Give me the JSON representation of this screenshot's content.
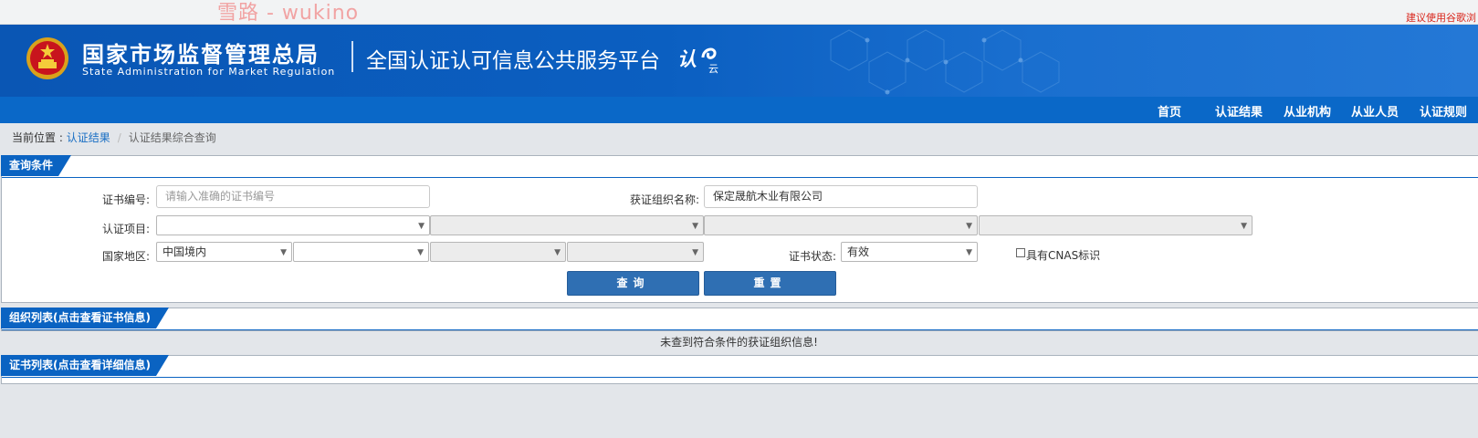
{
  "watermark": "雪路 - wukino",
  "browser_tip": "建议使用谷歌浏",
  "header": {
    "agency_cn": "国家市场监督管理总局",
    "agency_en": "State Administration  for  Market Regulation",
    "platform": "全国认证认可信息公共服务平台",
    "logo_r": "认",
    "logo_y": "云"
  },
  "nav": [
    "首页",
    "认证结果",
    "从业机构",
    "从业人员",
    "认证规则"
  ],
  "breadcrumb": {
    "prefix": "当前位置 : ",
    "link": "认证结果",
    "current": "认证结果综合查询"
  },
  "query": {
    "title": "查询条件",
    "cert_no_label": "证书编号:",
    "cert_no_placeholder": "请输入准确的证书编号",
    "org_label": "获证组织名称:",
    "org_value": "保定晟航木业有限公司",
    "project_label": "认证项目:",
    "region_label": "国家地区:",
    "region_value": "中国境内",
    "status_label": "证书状态:",
    "status_value": "有效",
    "cnas_label": "具有CNAS标识",
    "search_button": "查询",
    "reset_button": "重置"
  },
  "org_list": {
    "title": "组织列表(点击查看证书信息)",
    "empty": "未查到符合条件的获证组织信息!"
  },
  "cert_list": {
    "title": "证书列表(点击查看详细信息)"
  },
  "colors": {
    "banner": "#0b5fc1",
    "nav": "#0a68c8",
    "button": "#2f6fb3",
    "tip": "#d9261c"
  }
}
